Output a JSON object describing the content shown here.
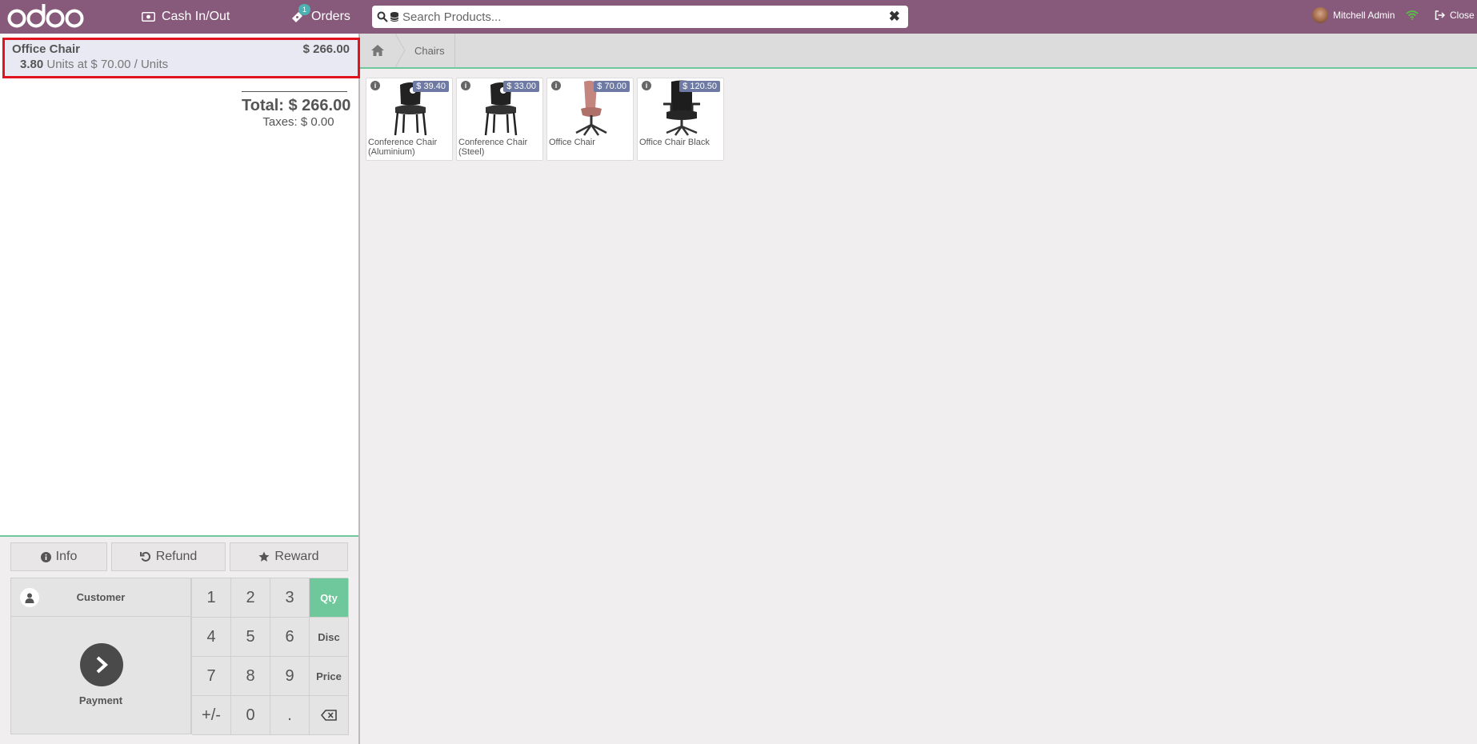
{
  "header": {
    "logo": "odoo",
    "cash_label": "Cash In/Out",
    "orders_label": "Orders",
    "orders_badge": "1",
    "search_placeholder": "Search Products...",
    "user_name": "Mitchell Admin",
    "close_label": "Close",
    "brand_color": "#875a7b"
  },
  "order": {
    "line": {
      "name": "Office Chair",
      "price": "$ 266.00",
      "qty": "3.80",
      "detail": "Units at $ 70.00 / Units"
    },
    "total_label": "Total: $ 266.00",
    "taxes_label": "Taxes: $ 0.00"
  },
  "controls": {
    "info_label": "Info",
    "refund_label": "Refund",
    "reward_label": "Reward",
    "customer_label": "Customer",
    "payment_label": "Payment",
    "keys": [
      "1",
      "2",
      "3",
      "Qty",
      "4",
      "5",
      "6",
      "Disc",
      "7",
      "8",
      "9",
      "Price",
      "+/-",
      "0",
      ".",
      "⌫"
    ],
    "active_mode": "Qty",
    "accent_color": "#6ec89b"
  },
  "breadcrumb": {
    "category": "Chairs"
  },
  "products": [
    {
      "name": "Conference Chair (Aluminium)",
      "price": "$ 39.40",
      "icon": "black-chair"
    },
    {
      "name": "Conference Chair (Steel)",
      "price": "$ 33.00",
      "icon": "black-chair"
    },
    {
      "name": "Office Chair",
      "price": "$ 70.00",
      "icon": "pink-swivel-chair"
    },
    {
      "name": "Office Chair Black",
      "price": "$ 120.50",
      "icon": "black-office-chair"
    }
  ]
}
